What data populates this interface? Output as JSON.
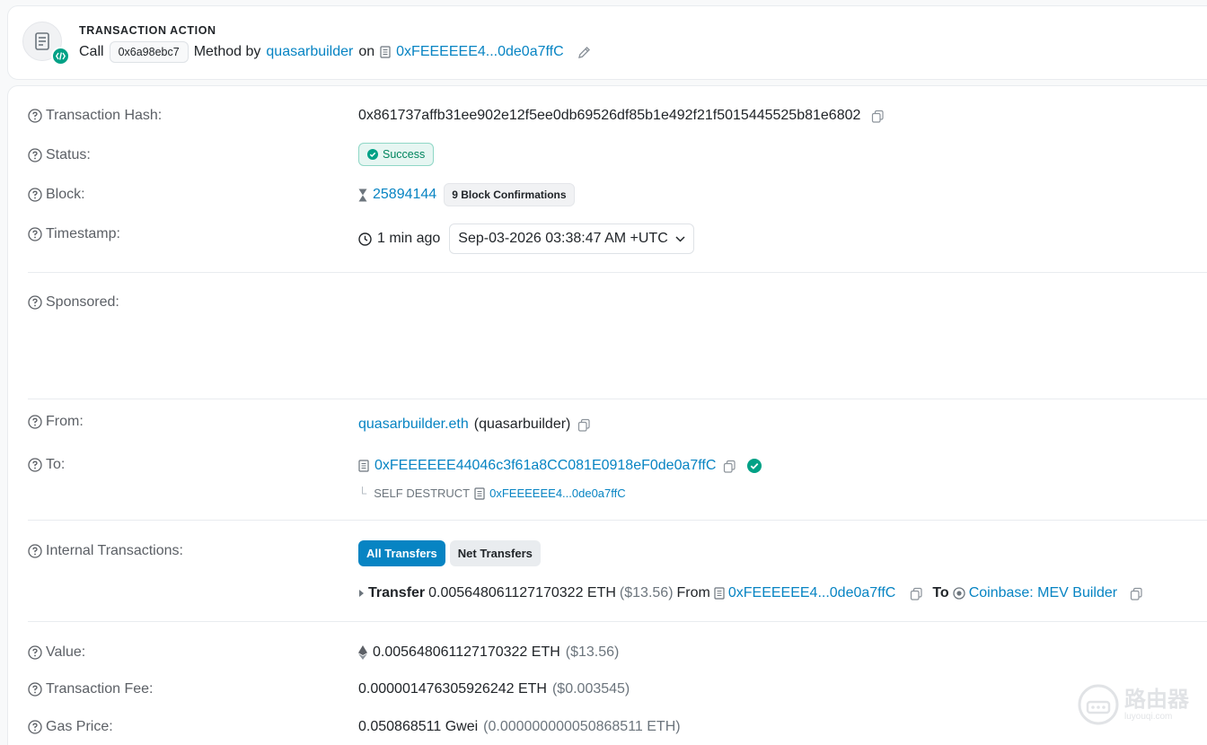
{
  "action": {
    "title": "TRANSACTION ACTION",
    "call": "Call",
    "method_id": "0x6a98ebc7",
    "method_by": "Method by",
    "builder": "quasarbuilder",
    "on": "on",
    "contract_short": "0xFEEEEEE4...0de0a7ffC"
  },
  "details": {
    "hash": {
      "label": "Transaction Hash:",
      "value": "0x861737affb31ee902e12f5ee0db69526df85b1e492f21f5015445525b81e6802"
    },
    "status": {
      "label": "Status:",
      "value": "Success"
    },
    "block": {
      "label": "Block:",
      "value": "25894144",
      "confirmations": "9 Block Confirmations"
    },
    "timestamp": {
      "label": "Timestamp:",
      "ago": "1 min ago",
      "value": "Sep-03-2026 03:38:47 AM +UTC"
    },
    "sponsored": {
      "label": "Sponsored:"
    },
    "from": {
      "label": "From:",
      "address": "quasarbuilder.eth",
      "name": "(quasarbuilder)"
    },
    "to": {
      "label": "To:",
      "address": "0xFEEEEEE44046c3f61a8CC081E0918eF0de0a7ffC",
      "self_destruct_label": "SELF DESTRUCT",
      "self_destruct_address": "0xFEEEEEE4...0de0a7ffC"
    },
    "internal": {
      "label": "Internal Transactions:",
      "tab_all": "All Transfers",
      "tab_net": "Net Transfers",
      "transfer_label": "Transfer",
      "amount": "0.005648061127170322 ETH",
      "usd": "($13.56)",
      "from_label": "From",
      "from_address": "0xFEEEEEE4...0de0a7ffC",
      "to_label": "To",
      "to_address": "Coinbase: MEV Builder"
    },
    "value": {
      "label": "Value:",
      "amount": "0.005648061127170322 ETH",
      "usd": "($13.56)"
    },
    "fee": {
      "label": "Transaction Fee:",
      "amount": "0.000001476305926242 ETH",
      "usd": "($0.003545)"
    },
    "gas": {
      "label": "Gas Price:",
      "amount": "0.050868511 Gwei",
      "eth": "(0.000000000050868511 ETH)"
    }
  },
  "watermark": {
    "text": "路由器",
    "sub": "luyouqi.com"
  },
  "colors": {
    "link": "#0784c3",
    "success": "#00a186",
    "tab_active": "#0784c3"
  },
  "icons": [
    "document-icon",
    "code-icon",
    "edit-icon",
    "help-icon",
    "copy-icon",
    "check-circle-icon",
    "hourglass-icon",
    "clock-icon",
    "chevron-down-icon",
    "contract-icon",
    "verified-icon",
    "ethereum-icon",
    "caret-right-icon",
    "coinbase-icon"
  ]
}
